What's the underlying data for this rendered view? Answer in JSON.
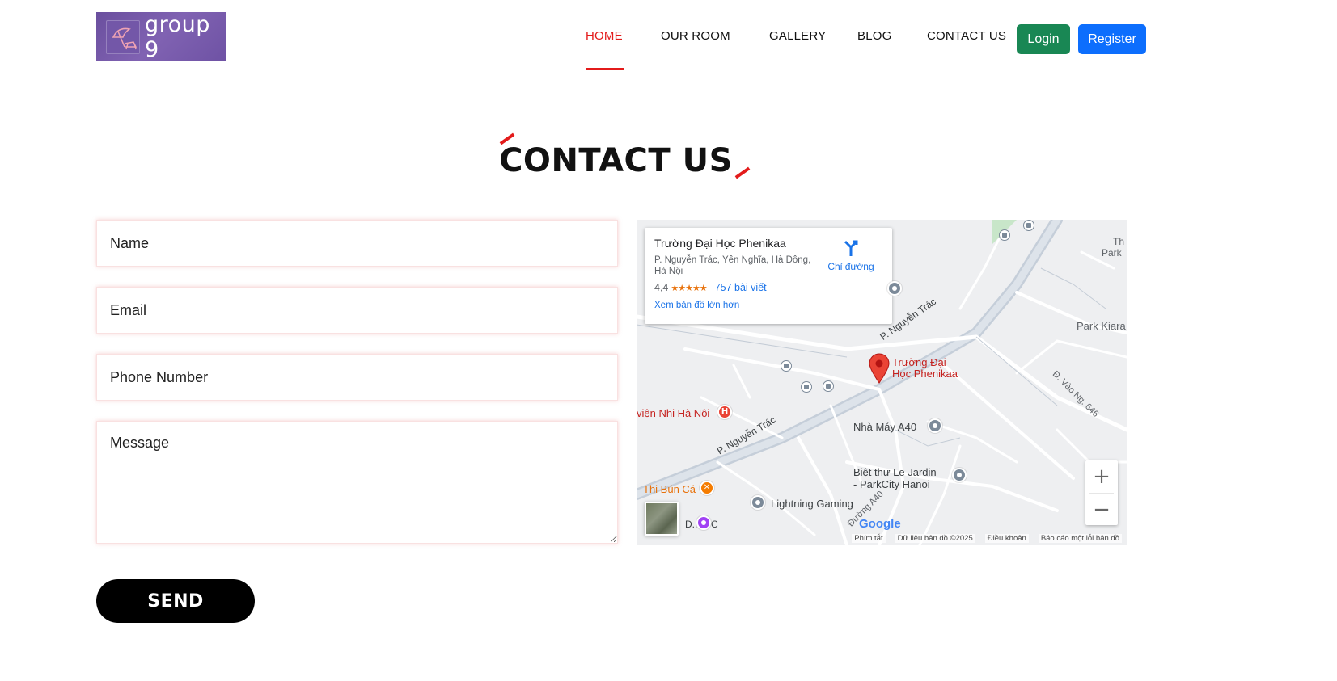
{
  "header": {
    "logo_text": "group 9",
    "nav": [
      {
        "label": "HOME",
        "active": true
      },
      {
        "label": "OUR ROOM",
        "active": false
      },
      {
        "label": "GALLERY",
        "active": false
      },
      {
        "label": "BLOG",
        "active": false
      },
      {
        "label": "CONTACT US",
        "active": false
      }
    ],
    "login_label": "Login",
    "register_label": "Register"
  },
  "page": {
    "title": "CONTACT US"
  },
  "form": {
    "name_placeholder": "Name",
    "email_placeholder": "Email",
    "phone_placeholder": "Phone Number",
    "message_placeholder": "Message",
    "send_label": "SEND"
  },
  "map": {
    "card": {
      "title": "Trường Đại Học Phenikaa",
      "address": "P. Nguyễn Trác, Yên Nghĩa, Hà Đông, Hà Nội",
      "rating": "4,4",
      "stars": "★★★★★",
      "reviews": "757 bài viết",
      "larger_map": "Xem bản đồ lớn hơn",
      "directions": "Chỉ đường"
    },
    "labels": {
      "road_top": "P. Nguyễn Trác",
      "road_bottom": "P. Nguyễn Trác",
      "pin": "Trường Đại Học Phenikaa",
      "pin_line1": "Trường Đại",
      "pin_line2": "Học Phenikaa",
      "hospital": "viện Nhi Hà Nội",
      "factory": "Nhà Máy A40",
      "villa_line1": "Biệt thự Le Jardin",
      "villa_line2": "- ParkCity Hanoi",
      "restaurant": "Thi Bún Cá",
      "gaming": "Lightning Gaming",
      "park_kiara": "Park Kiara",
      "park_top_line1": "Th",
      "park_top_line2": "Park",
      "road_a40": "Đường A40",
      "road_vao": "Đ. Vào Ng. 646",
      "poi_partial": "D... u C"
    },
    "footer": {
      "shortcuts": "Phím tắt",
      "data": "Dữ liệu bản đồ ©2025",
      "terms": "Điều khoản",
      "report": "Báo cáo một lỗi bản đồ"
    },
    "brand": "Google",
    "zoom_in": "+",
    "zoom_out": "−"
  },
  "colors": {
    "accent": "#e31b1b",
    "login": "#198754",
    "register": "#0d6efd",
    "logo_bg": "#7357a8"
  }
}
